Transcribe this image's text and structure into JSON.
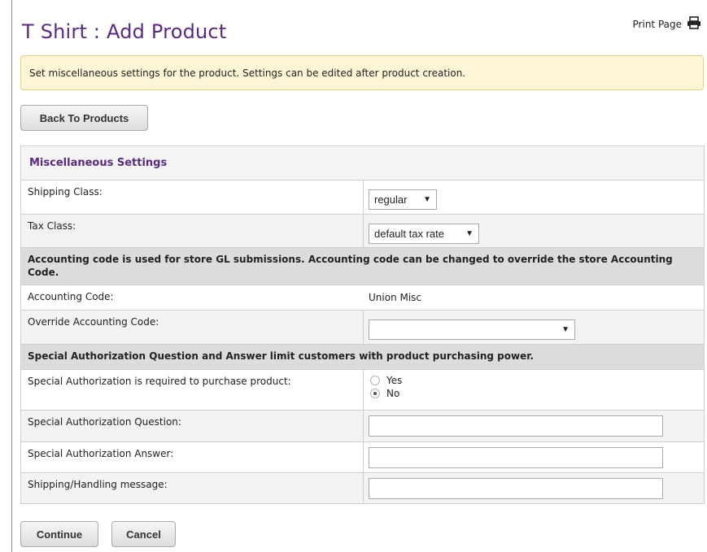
{
  "page": {
    "title": "T Shirt : Add Product",
    "print_label": "Print Page"
  },
  "notice": "Set miscellaneous settings for the product. Settings can be edited after product creation.",
  "buttons": {
    "back": "Back To Products",
    "continue": "Continue",
    "cancel": "Cancel"
  },
  "section": {
    "title": "Miscellaneous Settings",
    "shipping_class_label": "Shipping Class:",
    "shipping_class_value": "regular",
    "tax_class_label": "Tax Class:",
    "tax_class_value": "default tax rate",
    "accounting_note": "Accounting code is used for store GL submissions. Accounting code can be changed to override the store Accounting Code.",
    "accounting_code_label": "Accounting Code:",
    "accounting_code_value": "Union Misc",
    "override_label": "Override Accounting Code:",
    "override_value": "",
    "auth_note": "Special Authorization Question and Answer limit customers with product purchasing power.",
    "auth_required_label": "Special Authorization is required to purchase product:",
    "auth_options": [
      "Yes",
      "No"
    ],
    "auth_selected": "No",
    "auth_question_label": "Special Authorization Question:",
    "auth_question_value": "",
    "auth_answer_label": "Special Authorization Answer:",
    "auth_answer_value": "",
    "shipping_msg_label": "Shipping/Handling message:",
    "shipping_msg_value": ""
  },
  "icons": {
    "print": "printer-icon",
    "dropdown": "chevron-down-icon"
  }
}
